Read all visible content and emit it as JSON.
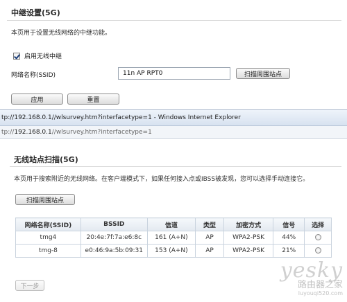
{
  "relay": {
    "title": "中继设置(5G)",
    "description": "本页用于设置无线网络的中继功能。",
    "enable_label": "启用无线中继",
    "enable_checked": true,
    "ssid_label": "网络名称(SSID)",
    "ssid_value": "11n AP RPT0",
    "scan_button": "扫描周围站点",
    "apply_button": "应用",
    "reset_button": "重置"
  },
  "browser": {
    "title_bar": "tp://192.168.0.1//wlsurvey.htm?interfacetype=1 - Windows Internet Explorer",
    "address_prefix": "tp://",
    "address_host": "192.168.0.1",
    "address_path": "//wlsurvey.htm?interfacetype=1"
  },
  "survey": {
    "title": "无线站点扫描(5G)",
    "description": "本页用于搜索附近的无线网络。在客户端模式下，如果任何接入点或IBSS被发现，您可以选择手动连接它。",
    "scan_button": "扫描周围站点",
    "columns": [
      "网络名称(SSID)",
      "BSSID",
      "信道",
      "类型",
      "加密方式",
      "信号",
      "选择"
    ],
    "rows": [
      {
        "ssid": "tmg4",
        "bssid": "20:4e:7f:7a:e6:8c",
        "channel": "161 (A+N)",
        "type": "AP",
        "encryption": "WPA2-PSK",
        "signal": "44%"
      },
      {
        "ssid": "tmg-8",
        "bssid": "e0:46:9a:5b:09:31",
        "channel": "153 (A+N)",
        "type": "AP",
        "encryption": "WPA2-PSK",
        "signal": "21%"
      }
    ],
    "next_button": "下一步"
  },
  "watermark": {
    "brand": "yesky",
    "brand2": "路由器之家",
    "url": "luyouqi520.com"
  }
}
